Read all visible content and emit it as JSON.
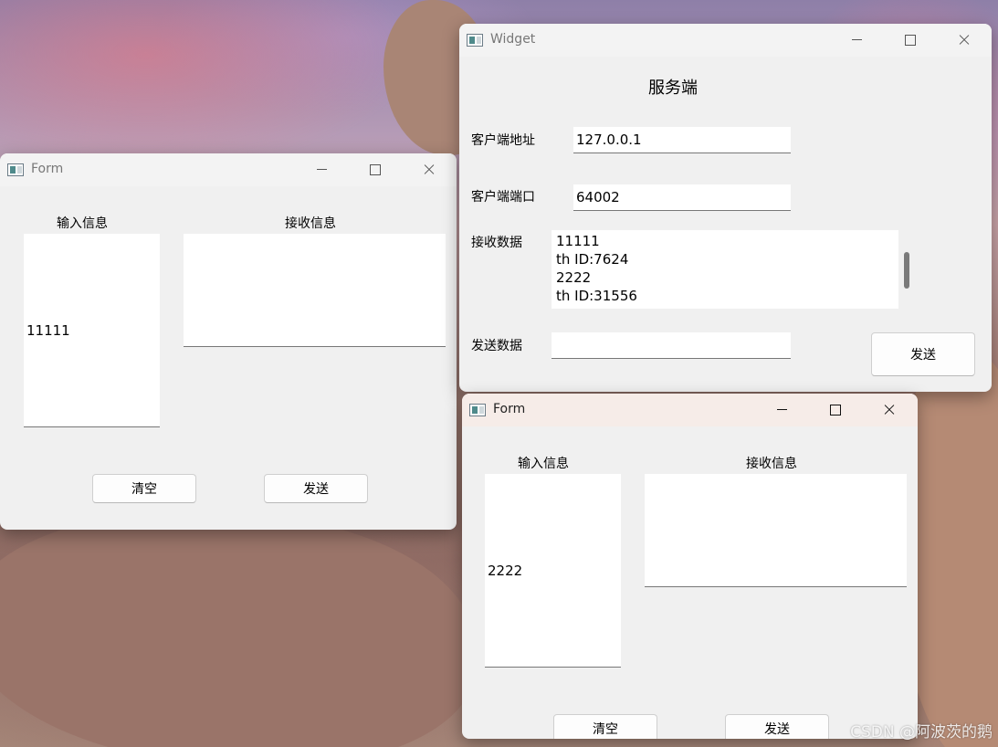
{
  "form_left": {
    "title": "Form",
    "input_label": "输入信息",
    "receive_label": "接收信息",
    "input_value": "11111",
    "receive_value": "",
    "clear_button": "清空",
    "send_button": "发送"
  },
  "widget": {
    "title": "Widget",
    "heading": "服务端",
    "client_address_label": "客户端地址",
    "client_address_value": "127.0.0.1",
    "client_port_label": "客户端端口",
    "client_port_value": "64002",
    "receive_data_label": "接收数据",
    "receive_data_value": "11111\nth ID:7624\n2222\nth ID:31556",
    "send_data_label": "发送数据",
    "send_data_value": "",
    "send_button": "发送"
  },
  "form_right": {
    "title": "Form",
    "input_label": "输入信息",
    "receive_label": "接收信息",
    "input_value": "2222",
    "receive_value": "",
    "clear_button": "清空",
    "send_button": "发送"
  },
  "watermark": "CSDN @阿波茨的鹅"
}
